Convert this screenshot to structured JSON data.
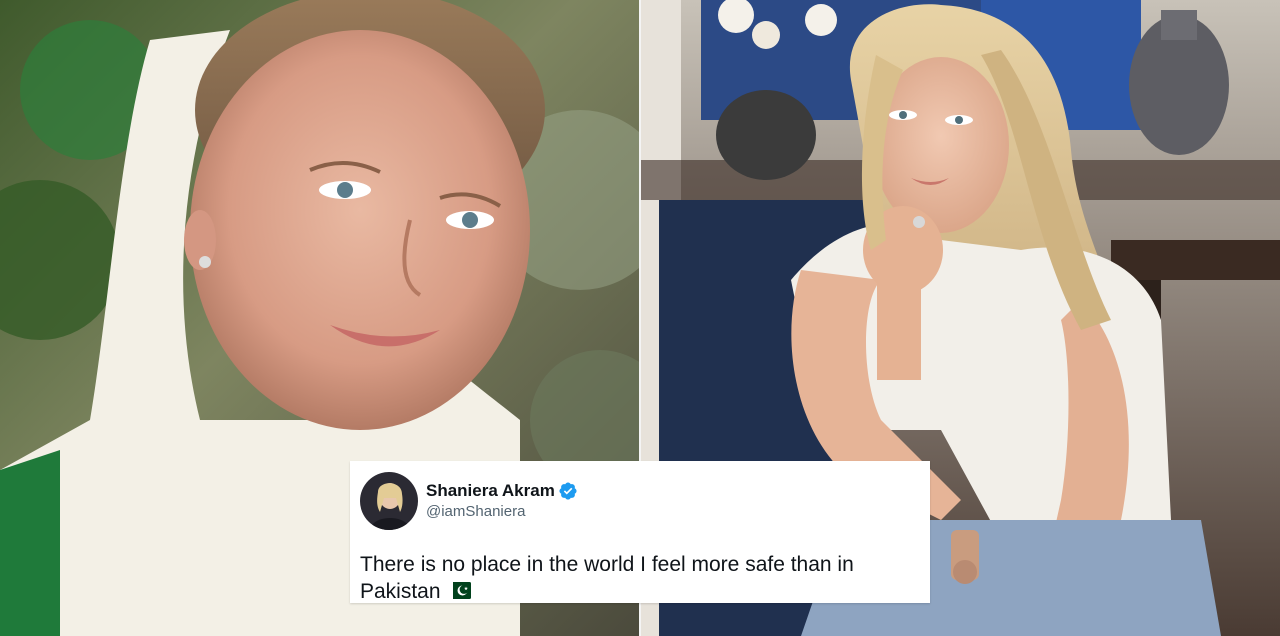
{
  "photos": {
    "left_description_icon": "portrait-photo-icon",
    "right_description_icon": "portrait-photo-icon"
  },
  "tweet": {
    "display_name": "Shaniera Akram",
    "handle": "@iamShaniera",
    "text": "There is no place in the world I feel more safe than in Pakistan",
    "emoji": "flag-pakistan-icon",
    "verified": true,
    "verified_icon": "verified-badge-icon",
    "colors": {
      "verified": "#1d9bf0",
      "name": "#0f1419",
      "handle": "#536471"
    }
  }
}
